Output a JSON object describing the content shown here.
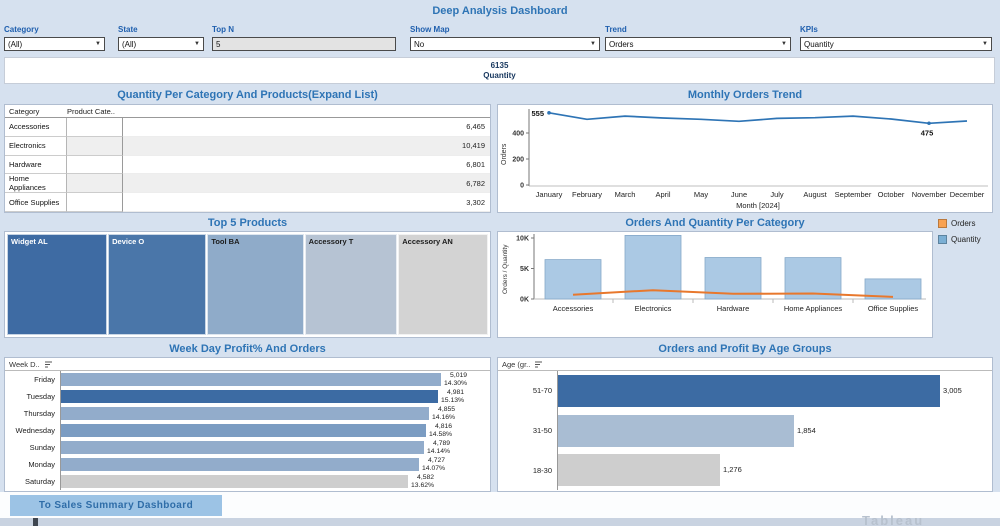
{
  "app": {
    "title": "Deep Analysis Dashboard"
  },
  "filters": [
    {
      "label": "Category",
      "value": "(All)"
    },
    {
      "label": "State",
      "value": "(All)"
    },
    {
      "label": "Top N",
      "value": "5"
    },
    {
      "label": "Show Map",
      "value": "No"
    },
    {
      "label": "Trend",
      "value": "Orders"
    },
    {
      "label": "KPIs",
      "value": "Quantity"
    }
  ],
  "kpi": {
    "value": "6135",
    "label": "Quantity"
  },
  "footer": {
    "button_label": "To Sales Summary Dashboard",
    "watermark": "Tableau"
  },
  "chart_data": [
    {
      "id": "monthly_orders_trend",
      "type": "line",
      "title": "Monthly Orders Trend",
      "x": [
        "January",
        "February",
        "March",
        "April",
        "May",
        "June",
        "July",
        "August",
        "September",
        "October",
        "November",
        "December"
      ],
      "series": [
        {
          "name": "Orders",
          "values": [
            555,
            505,
            530,
            515,
            505,
            490,
            512,
            518,
            530,
            508,
            475,
            492
          ]
        }
      ],
      "xlabel": "Month [2024]",
      "ylabel": "Orders",
      "yticks": [
        0,
        200,
        400
      ],
      "ylim": [
        0,
        580
      ],
      "grid": false,
      "annotations": [
        {
          "x": "January",
          "value": 555,
          "text": "555"
        },
        {
          "x": "November",
          "value": 475,
          "text": "475"
        }
      ],
      "line_color": "#2e74b5"
    },
    {
      "id": "orders_quantity_per_category",
      "type": "bar+line",
      "title": "Orders And Quantity Per Category",
      "categories": [
        "Accessories",
        "Electronics",
        "Hardware",
        "Home Appliances",
        "Office Supplies"
      ],
      "series": [
        {
          "name": "Orders",
          "mark": "line",
          "color": "#e8782d",
          "values": [
            700,
            1450,
            850,
            900,
            350
          ]
        },
        {
          "name": "Quantity",
          "mark": "bar",
          "color": "#abc9e4",
          "values": [
            6465,
            10419,
            6801,
            6782,
            3302
          ]
        }
      ],
      "ylabel": "Orders / Quantity",
      "ytick_labels": [
        "0K",
        "5K",
        "10K"
      ],
      "ylim": [
        0,
        10500
      ],
      "legend_position": "top-right",
      "legend": [
        {
          "label": "Orders",
          "color": "#f9a252"
        },
        {
          "label": "Quantity",
          "color": "#7bafd4"
        }
      ]
    },
    {
      "id": "quantity_per_category_and_products",
      "type": "table",
      "title": "Quantity Per Category And Products(Expand List)",
      "columns": [
        "Category",
        "Product Cate.."
      ],
      "rows": [
        {
          "category": "Accessories",
          "value": "6,465"
        },
        {
          "category": "Electronics",
          "value": "10,419"
        },
        {
          "category": "Hardware",
          "value": "6,801"
        },
        {
          "category": "Home Appliances",
          "value": "6,782"
        },
        {
          "category": "Office Supplies",
          "value": "3,302"
        }
      ]
    },
    {
      "id": "top_5_products",
      "type": "treemap",
      "title": "Top 5 Products",
      "items": [
        {
          "label": "Widget AL",
          "weight": 101,
          "color": "#3e6ba3",
          "text_color": "#ffffff"
        },
        {
          "label": "Device O",
          "weight": 99,
          "color": "#4a76a9",
          "text_color": "#ffffff"
        },
        {
          "label": "Tool BA",
          "weight": 97,
          "color": "#8fabc9",
          "text_color": "#1b1b1b"
        },
        {
          "label": "Accessory T",
          "weight": 93,
          "color": "#b6c3d3",
          "text_color": "#1b1b1b"
        },
        {
          "label": "Accessory AN",
          "weight": 90,
          "color": "#d3d3d3",
          "text_color": "#1b1b1b"
        }
      ]
    },
    {
      "id": "weekday_profit_and_orders",
      "type": "bar",
      "orientation": "horizontal",
      "title": "Week Day Profit% And Orders",
      "header": "Week D..",
      "categories": [
        "Friday",
        "Tuesday",
        "Thursday",
        "Wednesday",
        "Sunday",
        "Monday",
        "Saturday"
      ],
      "values": [
        5019,
        4981,
        4855,
        4816,
        4789,
        4727,
        4582
      ],
      "value_labels": [
        "5,019",
        "4,981",
        "4,855",
        "4,816",
        "4,789",
        "4,727",
        "4,582"
      ],
      "profit_labels": [
        "14.30%",
        "15.13%",
        "14.16%",
        "14.58%",
        "14.14%",
        "14.07%",
        "13.62%"
      ],
      "bar_colors": [
        "#92accb",
        "#3c6ba3",
        "#92accb",
        "#7b9cc2",
        "#92accb",
        "#92accb",
        "#cecece"
      ],
      "xmax": 5019
    },
    {
      "id": "orders_and_profit_by_age_groups",
      "type": "bar",
      "orientation": "horizontal",
      "title": "Orders and Profit By Age Groups",
      "header": "Age (gr..",
      "categories": [
        "51-70",
        "31-50",
        "18-30"
      ],
      "values": [
        3005,
        1854,
        1276
      ],
      "value_labels": [
        "3,005",
        "1,854",
        "1,276"
      ],
      "bar_colors": [
        "#3c6ba3",
        "#a9bdd3",
        "#cecece"
      ],
      "xmax": 3005
    }
  ]
}
